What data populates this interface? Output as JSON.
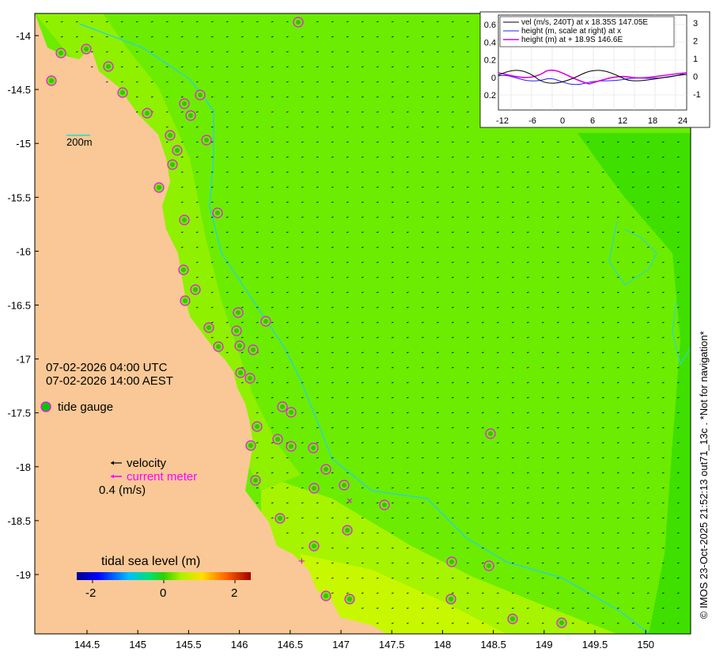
{
  "map": {
    "x_ticks": [
      "144.5",
      "145",
      "145.5",
      "146",
      "146.5",
      "147",
      "147.5",
      "148",
      "148.5",
      "149",
      "149.5",
      "150"
    ],
    "y_ticks": [
      "-14",
      "-14.5",
      "-15",
      "-15.5",
      "-16",
      "-16.5",
      "-17",
      "-17.5",
      "-18",
      "-18.5",
      "-19"
    ],
    "contour_label": "200m",
    "time_utc": "07-02-2026 04:00 UTC",
    "time_local": "07-02-2026 14:00 AEST",
    "legend_tide_gauge": "tide gauge",
    "legend_velocity": "velocity",
    "legend_current_meter": "current meter",
    "velocity_scale": "0.4 (m/s)",
    "colorbar_title": "tidal sea level (m)",
    "colorbar_ticks": [
      "-2",
      "0",
      "2"
    ],
    "credit": "© IMOS 23-Oct-2025 21:52:13 out71_13c . *Not for navigation*",
    "colors": {
      "land": "#f9c896",
      "sea_main": "#6cec00",
      "sea_offshore": "#3fe000",
      "sea_south": "#a6f400",
      "sea_coastal": "#8ff000",
      "isobath": "#28d8c8",
      "gauge": "#ff00ff",
      "gauge_fill": "#00c800"
    }
  },
  "inset": {
    "left_ticks": [
      "0.6",
      "0.4",
      "0.2",
      "0",
      "0.2"
    ],
    "right_ticks": [
      "3",
      "2",
      "1",
      "0",
      "-1"
    ],
    "x_ticks": [
      "-12",
      "-6",
      "0",
      "6",
      "12",
      "18",
      "24"
    ],
    "legend": [
      {
        "label": "vel (m/s, 240T) at x 18.35S 147.05E",
        "color": "#000000"
      },
      {
        "label": "height (m, scale at right) at x",
        "color": "#2020ff"
      },
      {
        "label": "height (m) at + 18.9S 146.6E",
        "color": "#e000e0"
      }
    ]
  }
}
